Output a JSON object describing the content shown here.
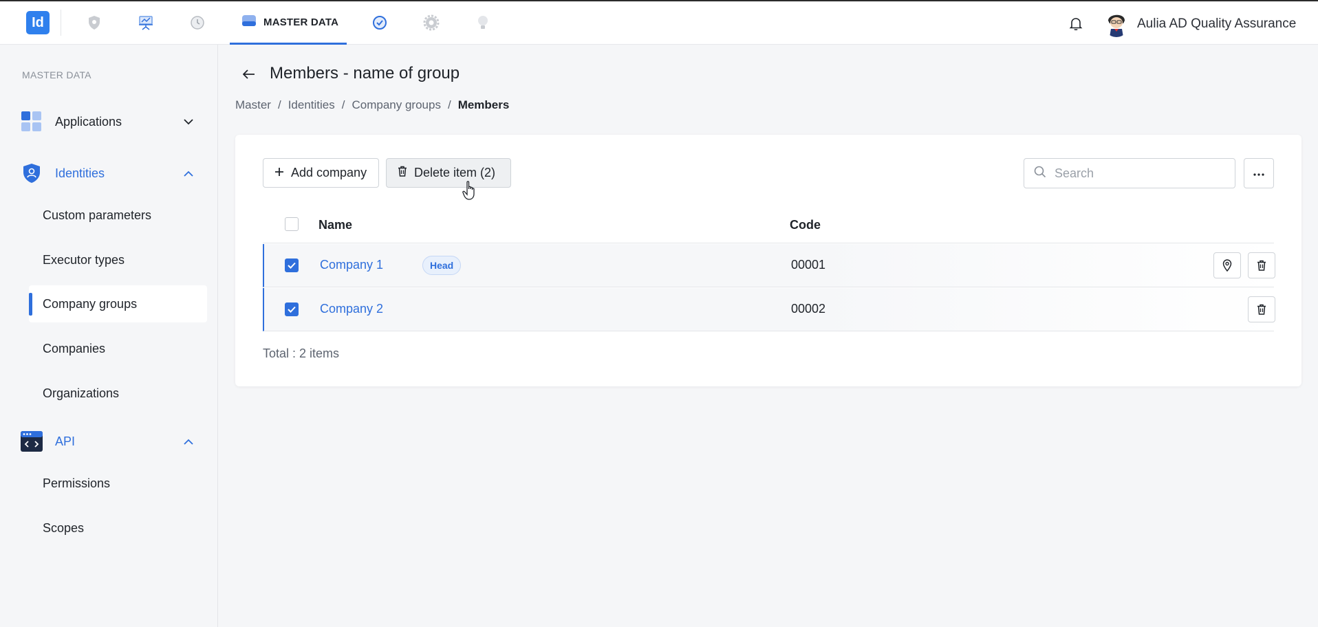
{
  "app": {
    "logo_text": "Id",
    "active_tab_label": "MASTER DATA",
    "user_name": "Aulia AD Quality Assurance"
  },
  "nav_icons": [
    "shield-icon",
    "presentation-icon",
    "history-icon",
    "database-icon",
    "verified-icon",
    "settings-icon",
    "bulb-icon"
  ],
  "sidebar": {
    "caption": "MASTER DATA",
    "groups": [
      {
        "label": "Applications",
        "icon": "grid-icon",
        "expanded": false
      },
      {
        "label": "Identities",
        "icon": "shield-user-icon",
        "expanded": true,
        "items": [
          "Custom parameters",
          "Executor types",
          "Company groups",
          "Companies",
          "Organizations"
        ]
      },
      {
        "label": "API",
        "icon": "code-window-icon",
        "expanded": true,
        "items": [
          "Permissions",
          "Scopes"
        ]
      }
    ],
    "selected_item": "Company groups"
  },
  "page": {
    "title": "Members - name of group",
    "breadcrumb": [
      "Master",
      "Identities",
      "Company groups",
      "Members"
    ]
  },
  "toolbar": {
    "add_label": "Add company",
    "delete_label": "Delete item (2)",
    "search_placeholder": "Search"
  },
  "table": {
    "columns": [
      "Name",
      "Code"
    ],
    "rows": [
      {
        "name": "Company 1",
        "badge": "Head",
        "code": "00001",
        "checked": true
      },
      {
        "name": "Company 2",
        "badge": "",
        "code": "00002",
        "checked": true
      }
    ],
    "total_label": "Total : 2 items"
  },
  "colors": {
    "accent": "#2f6fdc",
    "logo": "#2f80ed"
  }
}
